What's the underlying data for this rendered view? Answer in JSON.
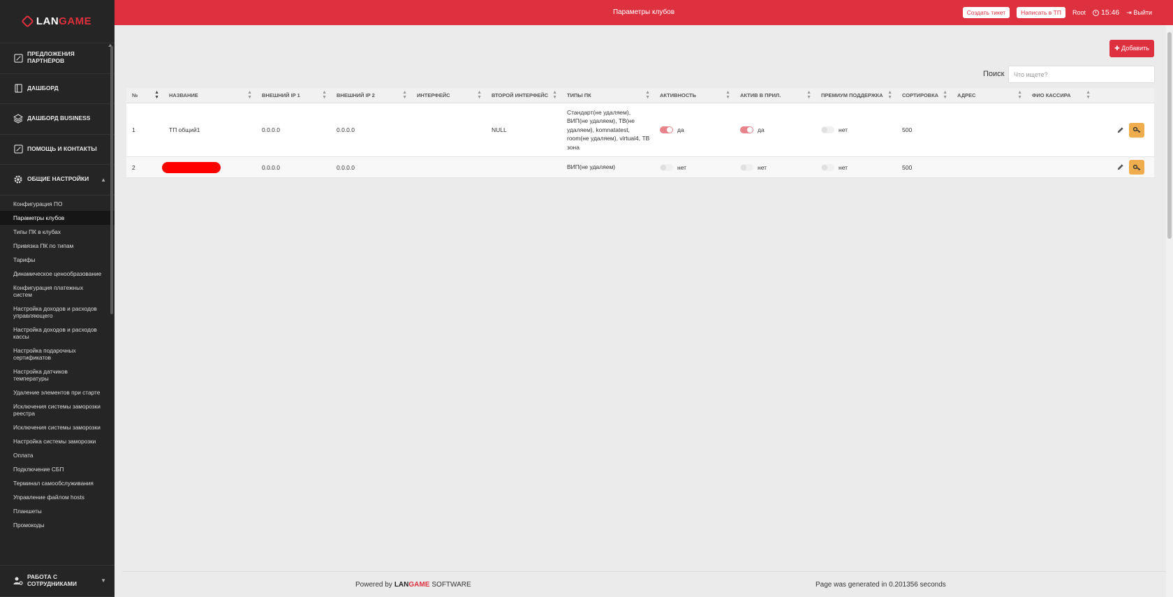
{
  "logo": {
    "part1": "LAN",
    "part2": "GAME"
  },
  "sidebar": {
    "sections": [
      {
        "label": "ПРЕДЛОЖЕНИЯ ПАРТНЁРОВ",
        "icon": "edit-square-icon"
      },
      {
        "label": "ДАШБОРД",
        "icon": "book-icon"
      },
      {
        "label": "ДАШБОРД BUSINESS",
        "icon": "layers-icon"
      },
      {
        "label": "ПОМОЩЬ И КОНТАКТЫ",
        "icon": "edit-square-icon"
      },
      {
        "label": "ОБЩИЕ НАСТРОЙКИ",
        "icon": "gear-icon"
      }
    ],
    "sub_items": [
      "Конфигурация ПО",
      "Параметры клубов",
      "Типы ПК в клубах",
      "Привязка ПК по типам",
      "Тарифы",
      "Динамическое ценообразование",
      "Конфигурация платежных систем",
      "Настройка доходов и расходов управляющего",
      "Настройка доходов и расходов кассы",
      "Настройка подарочных сертификатов",
      "Настройка датчиков температуры",
      "Удаление элементов при старте",
      "Исключения системы заморозки реестра",
      "Исключения системы заморозки",
      "Настройка системы заморозки",
      "Оплата",
      "Подключение СБП",
      "Терминал самообслуживания",
      "Управление файлом hosts",
      "Планшеты",
      "Промокоды"
    ],
    "bottom_section": {
      "label": "РАБОТА С СОТРУДНИКАМИ",
      "icon": "users-gear-icon"
    }
  },
  "topbar": {
    "title": "Параметры клубов",
    "create_ticket": "Создать тикет",
    "write_support": "Написать в ТП",
    "user": "Root",
    "time": "15:46",
    "logout": "Выйти"
  },
  "toolbar": {
    "add_label": "Добавить",
    "search_label": "Поиск",
    "search_placeholder": "Что ищете?"
  },
  "table": {
    "headers": [
      "№",
      "НАЗВАНИЕ",
      "ВНЕШНИЙ IP 1",
      "ВНЕШНИЙ IP 2",
      "ИНТЕРФЕЙС",
      "ВТОРОЙ ИНТЕРФЕЙС",
      "ТИПЫ ПК",
      "АКТИВНОСТЬ",
      "АКТИВ В ПРИЛ.",
      "ПРЕМИУМ ПОДДЕРЖКА",
      "СОРТИРОВКА",
      "АДРЕС",
      "ФИО КАССИРА"
    ],
    "rows": [
      {
        "num": "1",
        "name": "ТП общий1",
        "ip1": "0.0.0.0",
        "ip2": "0.0.0.0",
        "iface": "",
        "iface2": "NULL",
        "types": "Стандарт(не удаляем), ВИП(не удаляем), ТВ(не удаляем), komnatatest, room(не удаляем), virtual4, ТВ зона",
        "active": "да",
        "active_app": "да",
        "premium": "нет",
        "sort": "500",
        "address": "",
        "cashier": ""
      },
      {
        "num": "2",
        "name": "",
        "ip1": "0.0.0.0",
        "ip2": "0.0.0.0",
        "iface": "",
        "iface2": "",
        "types": "ВИП(не удаляем)",
        "active": "нет",
        "active_app": "нет",
        "premium": "нет",
        "sort": "500",
        "address": "",
        "cashier": ""
      }
    ]
  },
  "footer": {
    "powered_by": "Powered by",
    "brand1": "LAN",
    "brand2": "GAME",
    "software": "SOFTWARE",
    "generated": "Page was generated in 0.201356 seconds"
  },
  "colors": {
    "accent": "#dd3140",
    "sidebar_bg": "#252526",
    "key_button": "#f0ad4e"
  }
}
